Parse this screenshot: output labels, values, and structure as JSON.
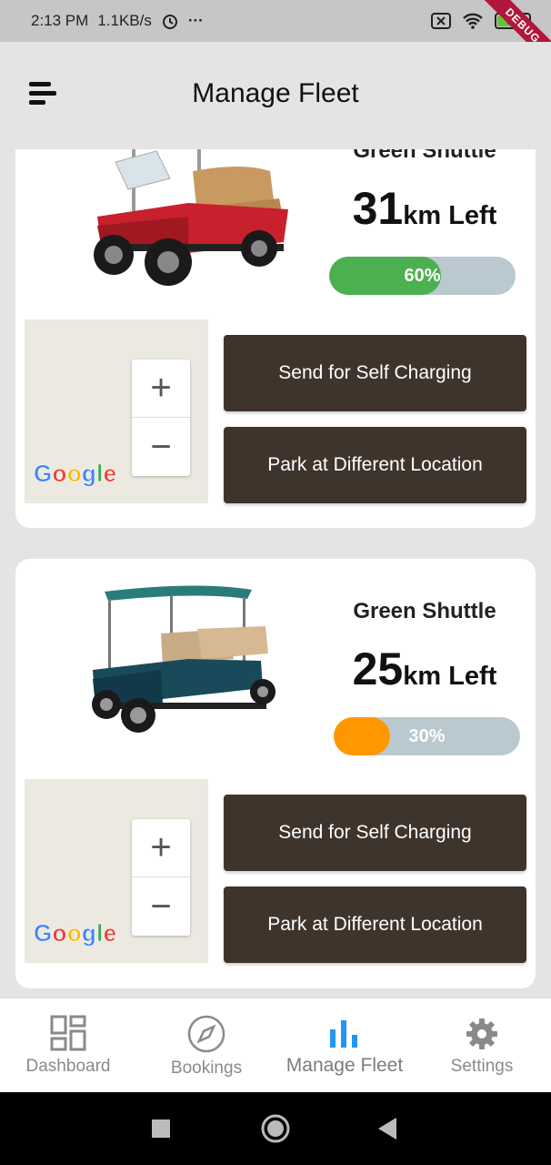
{
  "status_bar": {
    "time": "2:13 PM",
    "speed": "1.1KB/s",
    "more": "···",
    "battery_level": "94",
    "debug_banner": "DEBUG"
  },
  "app_bar": {
    "title": "Manage Fleet"
  },
  "vehicles": [
    {
      "name": "Green Shuttle",
      "range_value": "31",
      "range_unit": "km Left",
      "battery_percent_label": "60%",
      "battery_fraction": 0.6,
      "bar_color": "#4caf50",
      "image": "red-golf-cart",
      "map_logo": "Google",
      "zoom_in": "+",
      "zoom_out": "−",
      "buttons": {
        "charge": "Send for Self Charging",
        "park": "Park at Different Location"
      }
    },
    {
      "name": "Green Shuttle",
      "range_value": "25",
      "range_unit": "km Left",
      "battery_percent_label": "30%",
      "battery_fraction": 0.3,
      "bar_color": "#ff9800",
      "image": "teal-six-seat-golf-cart",
      "map_logo": "Google",
      "zoom_in": "+",
      "zoom_out": "−",
      "buttons": {
        "charge": "Send for Self Charging",
        "park": "Park at Different Location"
      }
    }
  ],
  "bottom_nav": {
    "items": [
      {
        "label": "Dashboard",
        "icon": "dashboard-icon"
      },
      {
        "label": "Bookings",
        "icon": "compass-icon"
      },
      {
        "label": "Manage Fleet",
        "icon": "bar-chart-icon",
        "active": true
      },
      {
        "label": "Settings",
        "icon": "gear-icon"
      }
    ]
  },
  "colors": {
    "accent": "#2196f3",
    "button_bg": "#3f342c",
    "progress_track": "#b9c9cf"
  }
}
